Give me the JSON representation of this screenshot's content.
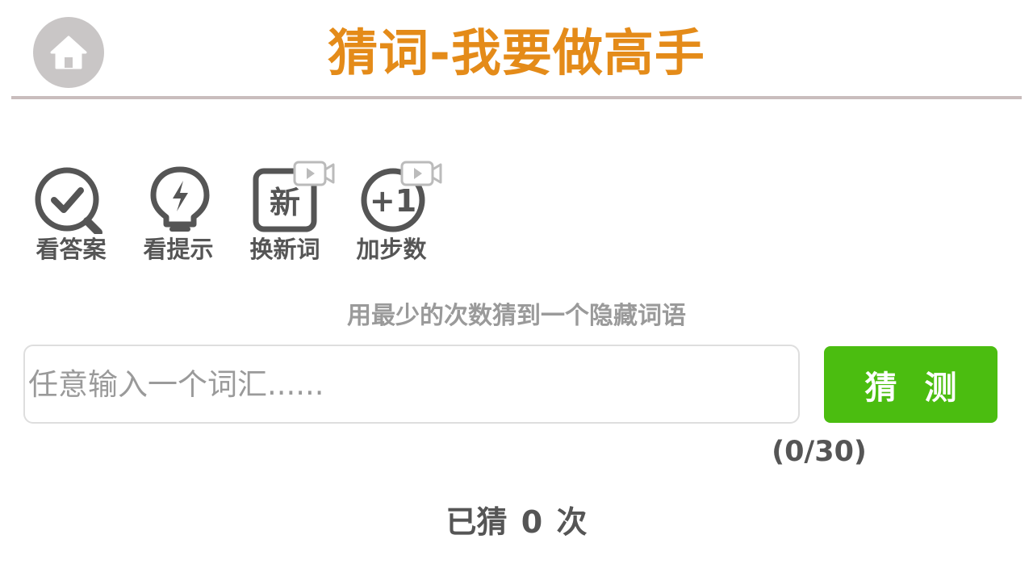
{
  "header": {
    "title": "猜词-我要做高手",
    "icon": "home-icon",
    "title_color": "#e48b19"
  },
  "tools": [
    {
      "label": "看答案",
      "icon": "magnifier-check-icon",
      "has_video_badge": false
    },
    {
      "label": "看提示",
      "icon": "lightbulb-icon",
      "has_video_badge": false
    },
    {
      "label": "换新词",
      "icon": "new-word-icon",
      "icon_text": "新",
      "has_video_badge": true
    },
    {
      "label": "加步数",
      "icon": "plus-one-icon",
      "icon_text": "+1",
      "has_video_badge": true
    }
  ],
  "game": {
    "hint": "用最少的次数猜到一个隐藏词语",
    "input_placeholder": "任意输入一个词汇......",
    "input_value": "",
    "guess_button": "猜 测",
    "counter": "(0/30)",
    "status": "已猜 0 次"
  },
  "colors": {
    "accent": "#e48b19",
    "button": "#4bbd10",
    "icon": "#555555"
  }
}
